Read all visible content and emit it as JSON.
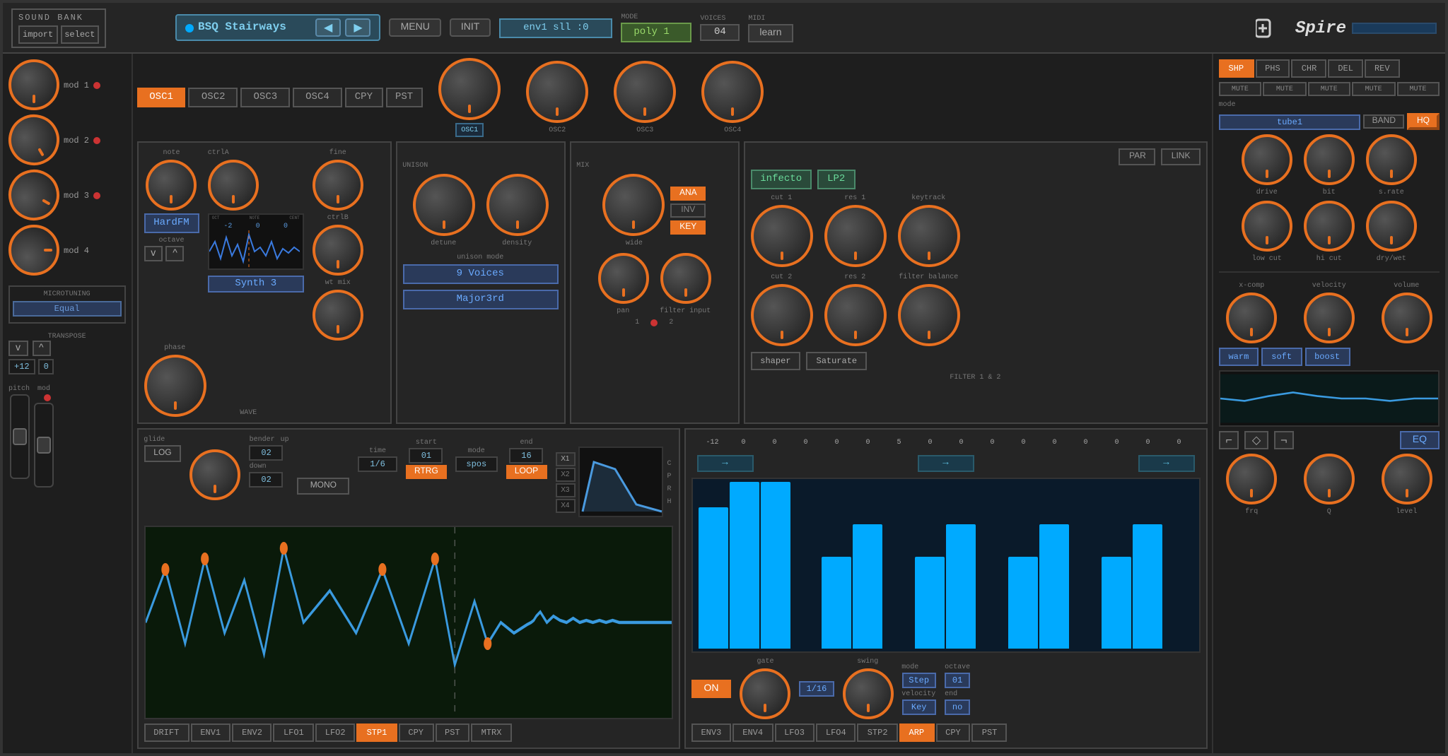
{
  "header": {
    "soundbank_label": "sound bank",
    "import_label": "import",
    "select_label": "select",
    "preset_name": "BSQ Stairways",
    "menu_label": "MENU",
    "init_label": "INIT",
    "env_display": "env1 sll   :0",
    "mode_label": "poly 1",
    "mode_title": "mode",
    "voices_title": "voices",
    "voices_value": "04",
    "midi_title": "midi",
    "learn_label": "learn",
    "spire_logo": "Spire"
  },
  "left": {
    "mod1_label": "mod 1",
    "mod2_label": "mod 2",
    "mod3_label": "mod 3",
    "mod4_label": "mod 4",
    "microtuning_label": "microtuning",
    "equal_label": "Equal",
    "transpose_label": "transpose",
    "transpose_up": "^",
    "transpose_down": "v",
    "transpose_val1": "+12",
    "transpose_val2": "0",
    "pitch_label": "pitch",
    "mod_label": "mod"
  },
  "osc": {
    "tabs": [
      "OSC1",
      "OSC2",
      "OSC3",
      "OSC4"
    ],
    "copy_label": "CPY",
    "paste_label": "PST",
    "note_label": "note",
    "hardfm_label": "HardFM",
    "octave_label": "octave",
    "down_arrow": "v",
    "up_arrow": "^",
    "wave_labels": [
      "OCT",
      "NOTE",
      "CENT"
    ],
    "wave_values": [
      "-2",
      "0",
      "0"
    ],
    "ctrla_label": "ctrlA",
    "ctrlb_label": "ctrlB",
    "fine_label": "fine",
    "wtmix_label": "wt mix",
    "synth3_label": "Synth 3",
    "wave_title": "WAVE",
    "phase_label": "phase"
  },
  "mix_osc": {
    "osc_labels": [
      "OSC1",
      "OSC2",
      "OSC3",
      "OSC4"
    ],
    "detune_label": "detune",
    "density_label": "density"
  },
  "unison": {
    "title": "UNISON",
    "detune_label": "detune",
    "density_label": "density",
    "unison_mode_label": "unison mode",
    "voices_display": "9 Voices",
    "chord_label": "Major3rd"
  },
  "mix": {
    "title": "MIX",
    "wide_label": "wide",
    "pan_label": "pan",
    "filter_input_label": "filter input",
    "ana_label": "ANA",
    "inv_label": "INV",
    "key_label": "KEY",
    "val1": "1",
    "val2": "2"
  },
  "filter": {
    "title": "FILTER 1 & 2",
    "par_label": "PAR",
    "link_label": "LINK",
    "filter1_label": "infecto",
    "filter2_label": "LP2",
    "cut1_label": "cut 1",
    "res1_label": "res 1",
    "keytrack_label": "keytrack",
    "cut2_label": "cut 2",
    "res2_label": "res 2",
    "filter_balance_label": "filter balance",
    "shaper_label": "shaper",
    "saturate_label": "Saturate"
  },
  "fx": {
    "tabs": [
      "SHP",
      "PHS",
      "CHR",
      "DEL",
      "REV"
    ],
    "mute_labels": [
      "MUTE",
      "MUTE",
      "MUTE",
      "MUTE",
      "MUTE"
    ],
    "mode_label": "mode",
    "mode_display": "tube1",
    "band_label": "BAND",
    "hq_label": "HQ",
    "drive_label": "drive",
    "bit_label": "bit",
    "srate_label": "s.rate",
    "low_cut_label": "low cut",
    "hi_cut_label": "hi cut",
    "dry_wet_label": "dry/wet"
  },
  "env_lfo": {
    "glide_label": "glide",
    "log_label": "LOG",
    "bender_up_label": "up",
    "bender_down_label": "down",
    "bender_label": "bender",
    "up_val": "02",
    "down_val": "02",
    "time_label": "time",
    "time_val": "1/6",
    "start_label": "start",
    "start_val": "01",
    "rtrg_label": "RTRG",
    "mode_label": "mode",
    "mode_val": "spos",
    "end_label": "end",
    "end_val": "16",
    "loop_label": "LOOP",
    "mono_label": "MONO",
    "x_labels": [
      "X1",
      "X2",
      "X3",
      "X4"
    ],
    "cprh_labels": [
      "C",
      "P",
      "R",
      "H"
    ],
    "tabs": [
      "DRIFT",
      "ENV1",
      "ENV2",
      "LFO1",
      "LFO2",
      "STP1",
      "CPY",
      "PST",
      "MTRX"
    ]
  },
  "arp": {
    "numbers": [
      "-12",
      "0",
      "0",
      "0",
      "0",
      "0",
      "5",
      "0",
      "0",
      "0",
      "0",
      "0",
      "0",
      "0",
      "0",
      "0"
    ],
    "bars": [
      85,
      100,
      100,
      0,
      55,
      75,
      0,
      55,
      75,
      0,
      55,
      75,
      0,
      55,
      75,
      0
    ],
    "on_label": "ON",
    "gate_label": "gate",
    "time_val": "1/16",
    "swing_label": "swing",
    "mode_label": "mode",
    "mode_val": "Step",
    "octave_label": "octave",
    "octave_val": "01",
    "velocity_label": "velocity",
    "velocity_val": "Key",
    "end_label": "end",
    "end_val": "no",
    "tabs": [
      "ENV3",
      "ENV4",
      "LFO3",
      "LFO4",
      "STP2",
      "ARP",
      "CPY",
      "PST"
    ]
  },
  "right_bottom": {
    "xcomp_label": "x-comp",
    "velocity_label": "velocity",
    "volume_label": "volume",
    "warm_label": "warm",
    "soft_label": "soft",
    "boost_label": "boost",
    "frq_label": "frq",
    "q_label": "Q",
    "level_label": "level",
    "eq_label": "EQ"
  }
}
